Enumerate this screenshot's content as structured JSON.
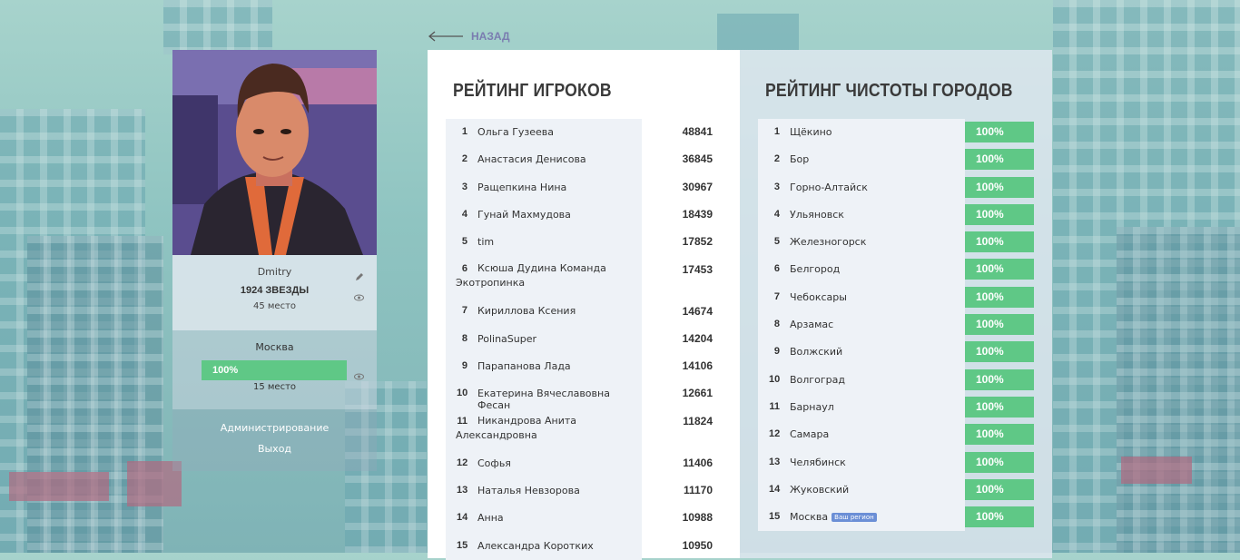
{
  "back_label": "НАЗАД",
  "profile": {
    "name": "Dmitry",
    "stars": "1924 ЗВЕЗДЫ",
    "place": "45 место",
    "city": "Москва",
    "city_percent": "100%",
    "city_percent_value": 100,
    "city_place": "15 место",
    "admin_link": "Администрирование",
    "logout_link": "Выход"
  },
  "players": {
    "title": "РЕЙТИНГ ИГРОКОВ",
    "rows": [
      {
        "rank": "1",
        "name": "Ольга Гузеева",
        "score": "48841"
      },
      {
        "rank": "2",
        "name": "Анастасия Денисова",
        "score": "36845"
      },
      {
        "rank": "3",
        "name": "Ращепкина Нина",
        "score": "30967"
      },
      {
        "rank": "4",
        "name": "Гунай Махмудова",
        "score": "18439"
      },
      {
        "rank": "5",
        "name": "tim",
        "score": "17852"
      },
      {
        "rank": "6",
        "name": "Ксюша Дудина Команда Экотропинка",
        "score": "17453"
      },
      {
        "rank": "7",
        "name": "Кириллова Ксения",
        "score": "14674"
      },
      {
        "rank": "8",
        "name": "PolinaSuper",
        "score": "14204"
      },
      {
        "rank": "9",
        "name": "Парапанова Лада",
        "score": "14106"
      },
      {
        "rank": "10",
        "name": "Екатерина Вячеславовна Фесан",
        "score": "12661"
      },
      {
        "rank": "11",
        "name": "Никандрова Анита Александровна",
        "score": "11824"
      },
      {
        "rank": "12",
        "name": "Софья",
        "score": "11406"
      },
      {
        "rank": "13",
        "name": "Наталья Невзорова",
        "score": "11170"
      },
      {
        "rank": "14",
        "name": "Анна",
        "score": "10988"
      },
      {
        "rank": "15",
        "name": "Александра Коротких",
        "score": "10950"
      }
    ]
  },
  "cities": {
    "title": "РЕЙТИНГ ЧИСТОТЫ ГОРОДОВ",
    "your_region_badge": "Ваш регион",
    "rows": [
      {
        "rank": "1",
        "name": "Щёкино",
        "percent": "100%"
      },
      {
        "rank": "2",
        "name": "Бор",
        "percent": "100%"
      },
      {
        "rank": "3",
        "name": "Горно-Алтайск",
        "percent": "100%"
      },
      {
        "rank": "4",
        "name": "Ульяновск",
        "percent": "100%"
      },
      {
        "rank": "5",
        "name": "Железногорск",
        "percent": "100%"
      },
      {
        "rank": "6",
        "name": "Белгород",
        "percent": "100%"
      },
      {
        "rank": "7",
        "name": "Чебоксары",
        "percent": "100%"
      },
      {
        "rank": "8",
        "name": "Арзамас",
        "percent": "100%"
      },
      {
        "rank": "9",
        "name": "Волжский",
        "percent": "100%"
      },
      {
        "rank": "10",
        "name": "Волгоград",
        "percent": "100%"
      },
      {
        "rank": "11",
        "name": "Барнаул",
        "percent": "100%"
      },
      {
        "rank": "12",
        "name": "Самара",
        "percent": "100%"
      },
      {
        "rank": "13",
        "name": "Челябинск",
        "percent": "100%"
      },
      {
        "rank": "14",
        "name": "Жуковский",
        "percent": "100%"
      },
      {
        "rank": "15",
        "name": "Москва",
        "percent": "100%",
        "your_region": true
      }
    ]
  },
  "colors": {
    "accent_green": "#5fc886",
    "back_link": "#7a7cb0",
    "badge_blue": "#6b8fd6"
  }
}
